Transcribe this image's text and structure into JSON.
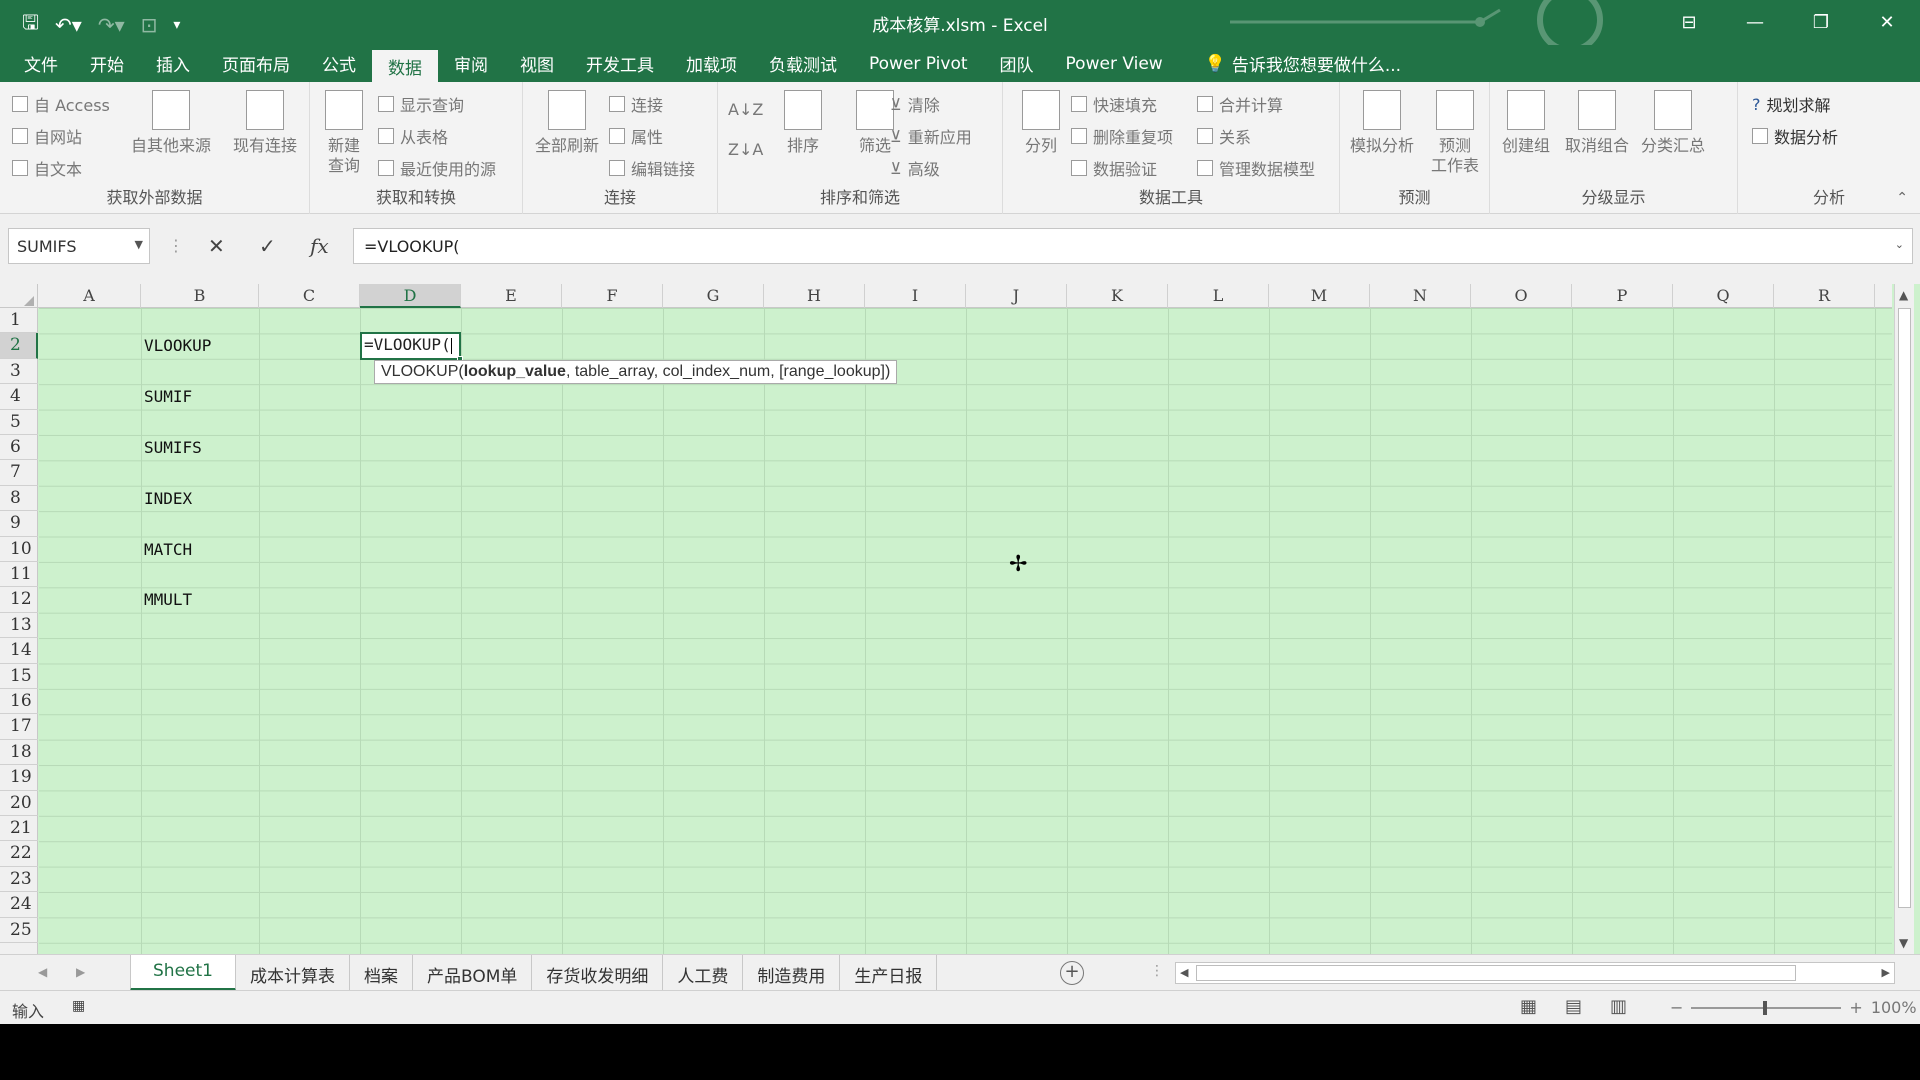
{
  "window": {
    "title": "成本核算.xlsm - Excel",
    "controls": [
      "restore-ribbon",
      "minimize",
      "maximize",
      "close"
    ]
  },
  "tabs": [
    "文件",
    "开始",
    "插入",
    "页面布局",
    "公式",
    "数据",
    "审阅",
    "视图",
    "开发工具",
    "加载项",
    "负载测试",
    "Power Pivot",
    "团队",
    "Power View"
  ],
  "active_tab": "数据",
  "tell_me": "告诉我您想要做什么...",
  "ribbon": {
    "external": {
      "label": "获取外部数据",
      "items": [
        "自 Access",
        "自网站",
        "自文本"
      ],
      "other": "自其他来源",
      "existing": "现有连接"
    },
    "transform": {
      "label": "获取和转换",
      "new_query": "新建\n查询",
      "items": [
        "显示查询",
        "从表格",
        "最近使用的源"
      ]
    },
    "connections": {
      "label": "连接",
      "refresh": "全部刷新",
      "items": [
        "连接",
        "属性",
        "编辑链接"
      ]
    },
    "sort": {
      "label": "排序和筛选",
      "sort": "排序",
      "filter": "筛选",
      "items": [
        "清除",
        "重新应用",
        "高级"
      ]
    },
    "tools": {
      "label": "数据工具",
      "split": "分列",
      "items": [
        "快速填充",
        "删除重复项",
        "数据验证"
      ],
      "items2": [
        "合并计算",
        "关系",
        "管理数据模型"
      ]
    },
    "forecast": {
      "label": "预测",
      "whatif": "模拟分析",
      "sheet": "预测\n工作表"
    },
    "outline": {
      "label": "分级显示",
      "group": "创建组",
      "ungroup": "取消组合",
      "subtotal": "分类汇总"
    },
    "analysis": {
      "label": "分析",
      "items": [
        "规划求解",
        "数据分析"
      ]
    }
  },
  "formula_bar": {
    "name_box": "SUMIFS",
    "formula": "=VLOOKUP("
  },
  "columns": [
    "A",
    "B",
    "C",
    "D",
    "E",
    "F",
    "G",
    "H",
    "I",
    "J",
    "K",
    "L",
    "M",
    "N",
    "O",
    "P",
    "Q",
    "R"
  ],
  "rows": [
    "1",
    "2",
    "3",
    "4",
    "5",
    "6",
    "7",
    "8",
    "9",
    "10",
    "11",
    "12",
    "13",
    "14",
    "15",
    "16",
    "17",
    "18",
    "19",
    "20",
    "21",
    "22",
    "23",
    "24",
    "25"
  ],
  "cells": [
    {
      "ref": "B2",
      "value": "VLOOKUP"
    },
    {
      "ref": "B4",
      "value": "SUMIF"
    },
    {
      "ref": "B6",
      "value": "SUMIFS"
    },
    {
      "ref": "B8",
      "value": "INDEX"
    },
    {
      "ref": "B10",
      "value": "MATCH"
    },
    {
      "ref": "B12",
      "value": "MMULT"
    }
  ],
  "active_cell": {
    "ref": "D2",
    "value": "=VLOOKUP("
  },
  "tooltip": {
    "fn": "VLOOKUP(",
    "arg1": "lookup_value",
    "rest": ", table_array, col_index_num, [range_lookup])"
  },
  "sheets": [
    "Sheet1",
    "成本计算表",
    "档案",
    "产品BOM单",
    "存货收发明细",
    "人工费",
    "制造费用",
    "生产日报"
  ],
  "active_sheet": "Sheet1",
  "status": {
    "mode": "输入",
    "zoom": "100%"
  },
  "colors": {
    "accent": "#217346",
    "cell_bg": "#cdf1cd"
  }
}
